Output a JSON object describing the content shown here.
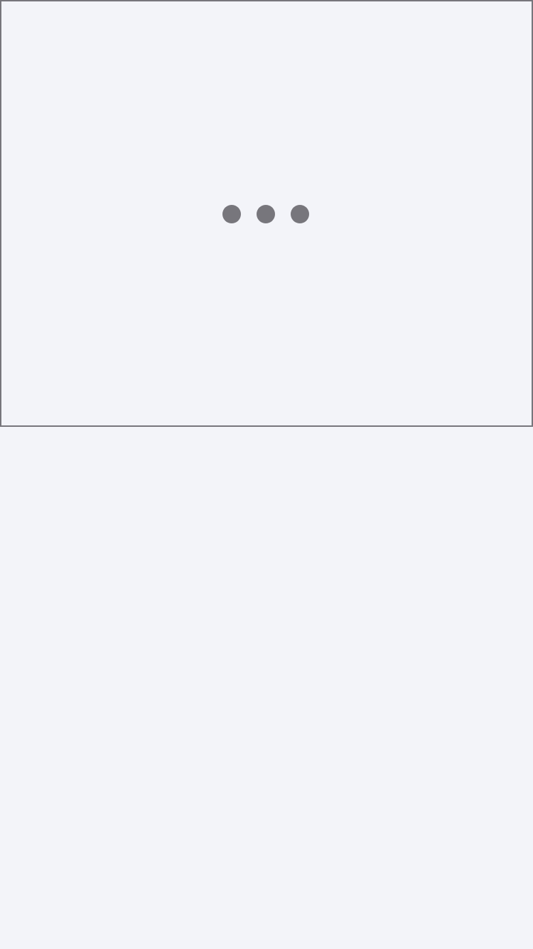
{
  "loading_panel": {
    "indicator_icon": "loading-dots-icon",
    "dot_count": 3,
    "colors": {
      "background": "#f3f4f9",
      "border": "#77767c",
      "dot": "#77767c"
    }
  }
}
